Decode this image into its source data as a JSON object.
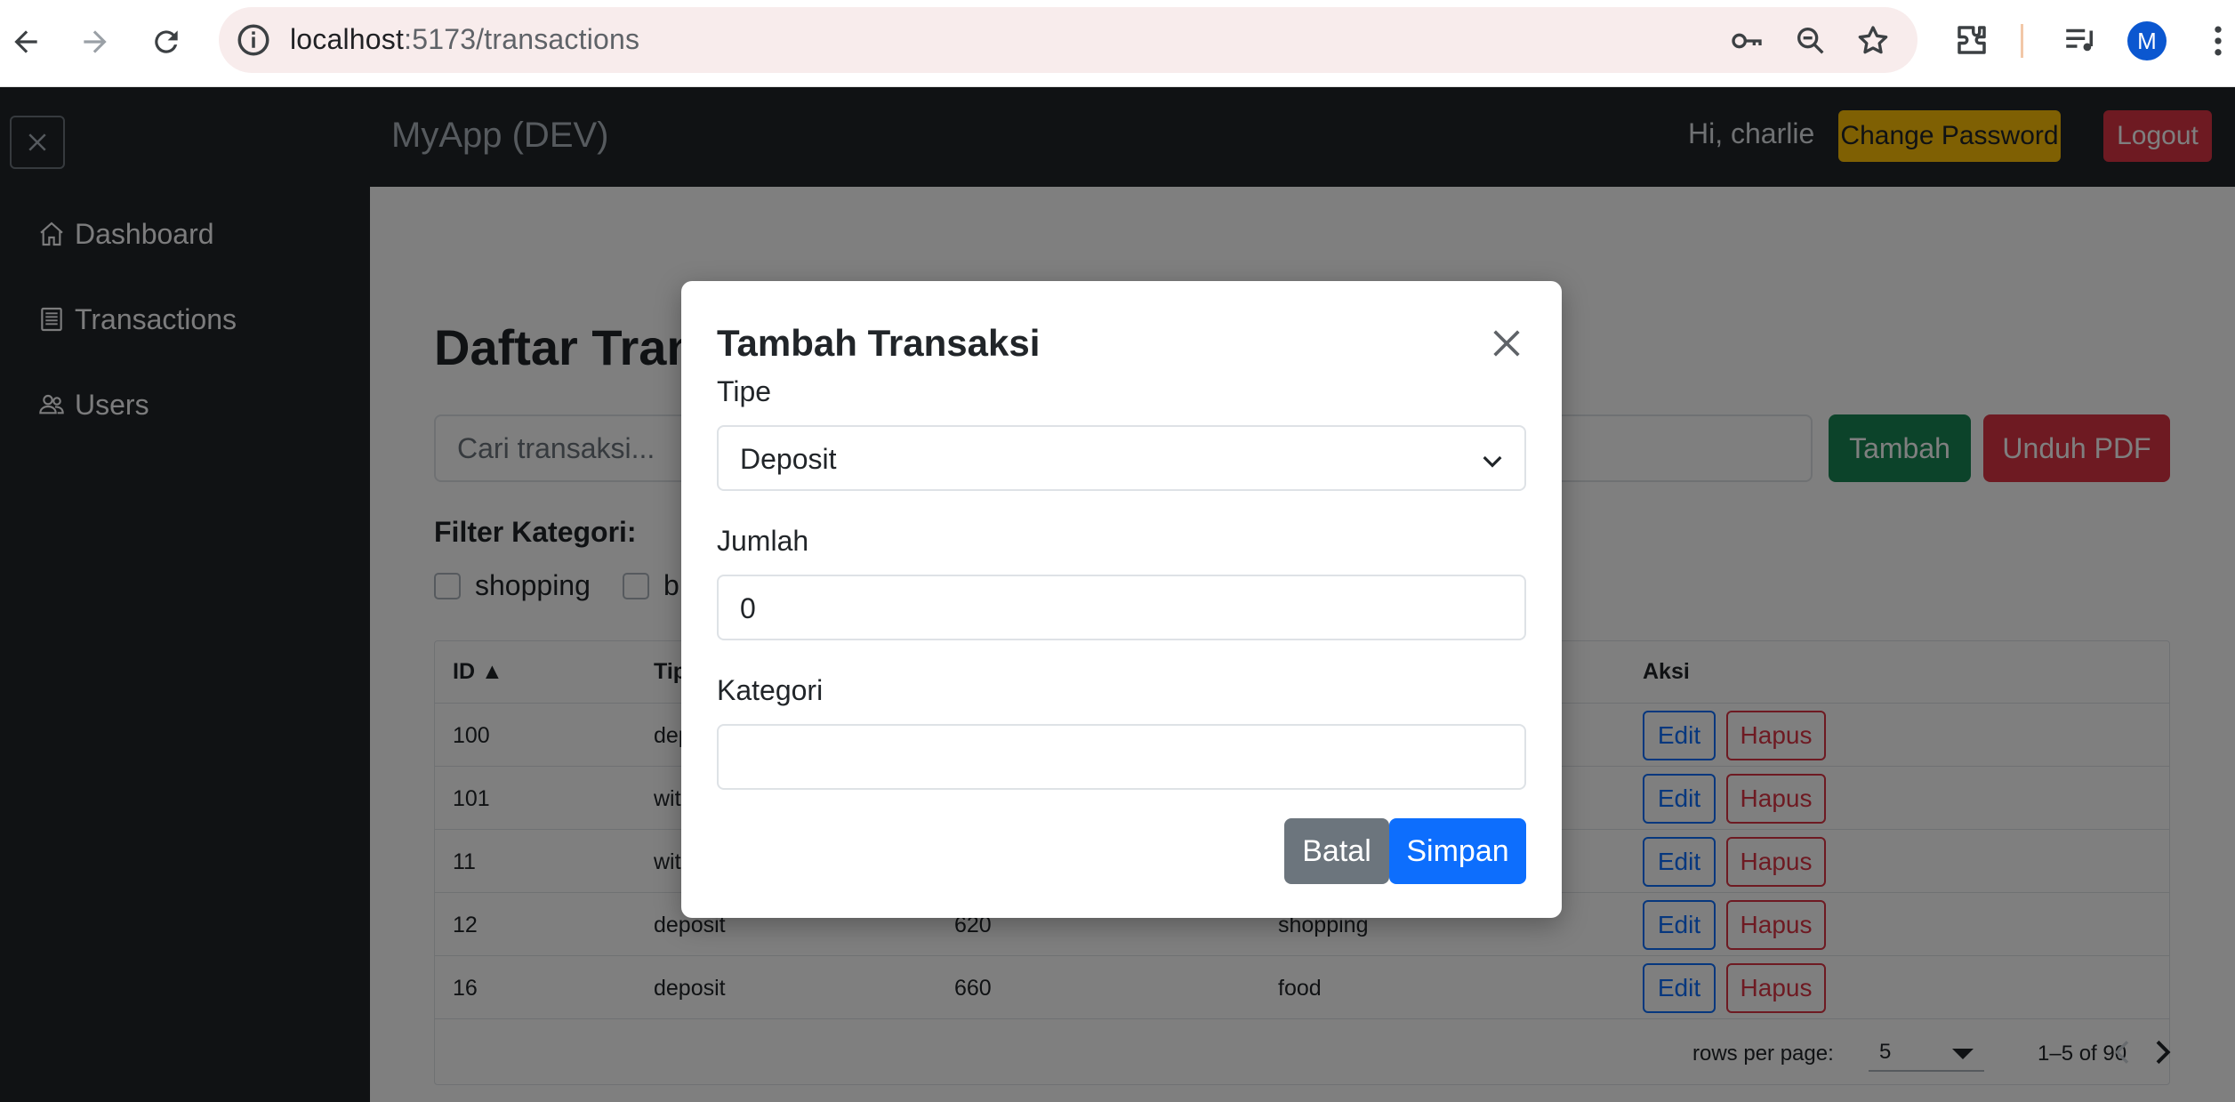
{
  "browser": {
    "url_host": "localhost",
    "url_path": ":5173/transactions",
    "profile_initial": "M"
  },
  "sidebar": {
    "items": [
      {
        "label": "Dashboard",
        "icon": "house-icon"
      },
      {
        "label": "Transactions",
        "icon": "list-icon"
      },
      {
        "label": "Users",
        "icon": "users-icon"
      }
    ]
  },
  "topnav": {
    "brand": "MyApp (DEV)",
    "greeting": "Hi, charlie",
    "change_password_label": "Change Password",
    "logout_label": "Logout"
  },
  "main": {
    "title": "Daftar Transaksi",
    "search_placeholder": "Cari transaksi...",
    "add_label": "Tambah",
    "pdf_label": "Unduh PDF",
    "filter_label": "Filter Kategori:",
    "filters": [
      "shopping",
      "b"
    ]
  },
  "table": {
    "headers": {
      "id": "ID ▲",
      "type": "Tip",
      "action": "Aksi"
    },
    "rows": [
      {
        "id": "100",
        "type": "dep",
        "amount": "",
        "category": ""
      },
      {
        "id": "101",
        "type": "wit",
        "amount": "",
        "category": ""
      },
      {
        "id": "11",
        "type": "wit",
        "amount": "",
        "category": ""
      },
      {
        "id": "12",
        "type": "deposit",
        "amount": "620",
        "category": "shopping"
      },
      {
        "id": "16",
        "type": "deposit",
        "amount": "660",
        "category": "food"
      }
    ],
    "edit_label": "Edit",
    "delete_label": "Hapus",
    "rows_per_page_label": "rows per page:",
    "rows_per_page": "5",
    "range": "1–5 of 90"
  },
  "modal": {
    "title": "Tambah Transaksi",
    "type_label": "Tipe",
    "type_value": "Deposit",
    "amount_label": "Jumlah",
    "amount_value": "0",
    "category_label": "Kategori",
    "category_value": "",
    "cancel_label": "Batal",
    "save_label": "Simpan"
  },
  "colors": {
    "dark": "#212529",
    "primary": "#0d6efd",
    "success": "#198754",
    "danger": "#dc3545",
    "warning": "#ffc107",
    "secondary": "#6c757d"
  }
}
